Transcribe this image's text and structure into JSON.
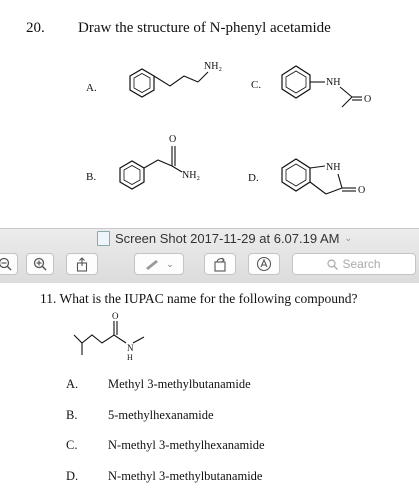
{
  "question20": {
    "number": "20.",
    "prompt": "Draw the structure of N-phenyl acetamide",
    "options": [
      {
        "letter": "A.",
        "label": "NH₂"
      },
      {
        "letter": "B.",
        "label": "NH₂"
      },
      {
        "letter": "C.",
        "label": "NH"
      },
      {
        "letter": "D.",
        "label": "NH"
      }
    ]
  },
  "window": {
    "title": "Screen Shot 2017-11-29 at 6.07.19 AM",
    "icons": [
      "zoom-out-icon",
      "zoom-in-icon",
      "share-icon",
      "markup-pen-icon",
      "chevron-down-icon",
      "rotate-icon",
      "annotate-icon",
      "search-icon"
    ],
    "search_placeholder": "Search"
  },
  "question11": {
    "prompt": "11. What is the IUPAC name for the following compound?",
    "n_label": "N",
    "h_label": "H",
    "answers": [
      {
        "letter": "A.",
        "text": "Methyl 3-methylbutanamide"
      },
      {
        "letter": "B.",
        "text": "5-methylhexanamide"
      },
      {
        "letter": "C.",
        "text": "N-methyl 3-methylhexanamide"
      },
      {
        "letter": "D.",
        "text": "N-methyl 3-methylbutanamide"
      }
    ]
  }
}
